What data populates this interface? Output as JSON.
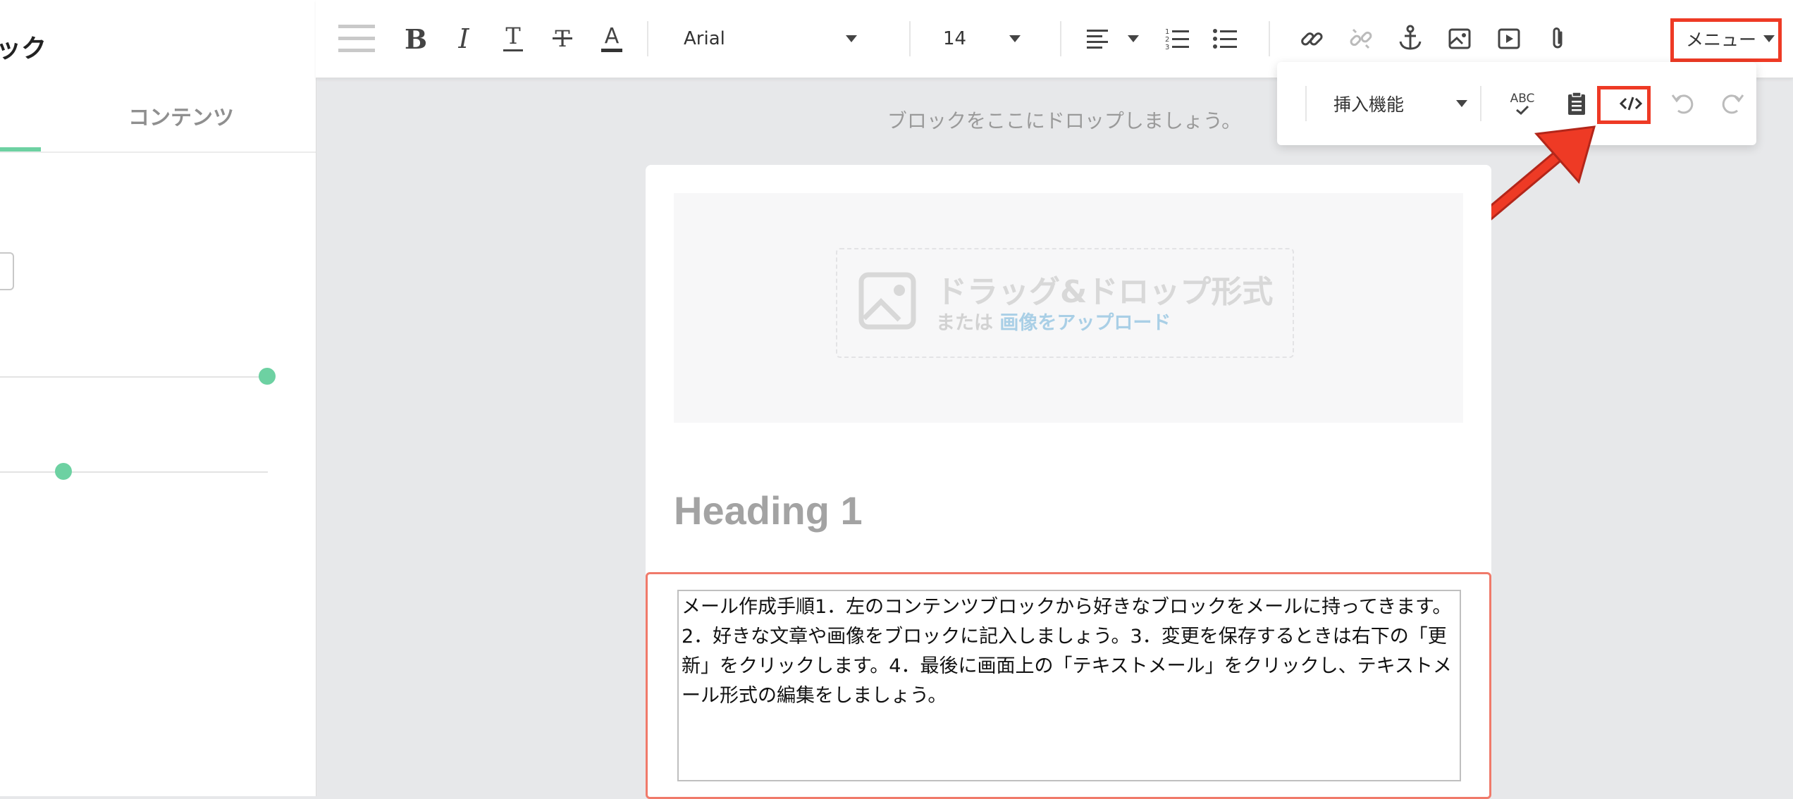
{
  "left_panel": {
    "title_fragment": "ック",
    "tabs": [
      {
        "label": "コンテンツ"
      }
    ],
    "sliders": [
      {
        "value": 1.0
      },
      {
        "value": 0.2
      }
    ]
  },
  "toolbar": {
    "font_family": "Arial",
    "font_size": "14",
    "menu_label": "メニュー",
    "icons": [
      "drag-handle-icon",
      "bold-icon",
      "italic-icon",
      "underline-icon",
      "strikethrough-icon",
      "font-color-icon",
      "align-icon",
      "ordered-list-icon",
      "unordered-list-icon",
      "link-icon",
      "unlink-icon",
      "anchor-icon",
      "image-icon",
      "video-icon",
      "attachment-icon"
    ]
  },
  "menu_dropdown": {
    "insert_label": "挿入機能",
    "spellcheck_label": "ABC",
    "icons": [
      "spellcheck-icon",
      "paste-icon",
      "code-view-icon",
      "undo-icon",
      "redo-icon"
    ]
  },
  "canvas": {
    "drop_hint": "ブロックをここにドロップしましょう。",
    "image_block": {
      "title": "ドラッグ&ドロップ形式",
      "sub_prefix": "または",
      "upload_link": "画像をアップロード"
    },
    "heading": "Heading 1",
    "text_content": "メール作成手順1．左のコンテンツブロックから好きなブロックをメールに持ってきます。2．好きな文章や画像をブロックに記入しましょう。3．変更を保存するときは右下の「更新」をクリックします。4．最後に画面上の「テキストメール」をクリックし、テキストメール形式の編集をしましょう。"
  },
  "colors": {
    "accent_green": "#6dd1a2",
    "highlight_red": "#ee3a25",
    "text_block_border": "#f07a6a"
  }
}
